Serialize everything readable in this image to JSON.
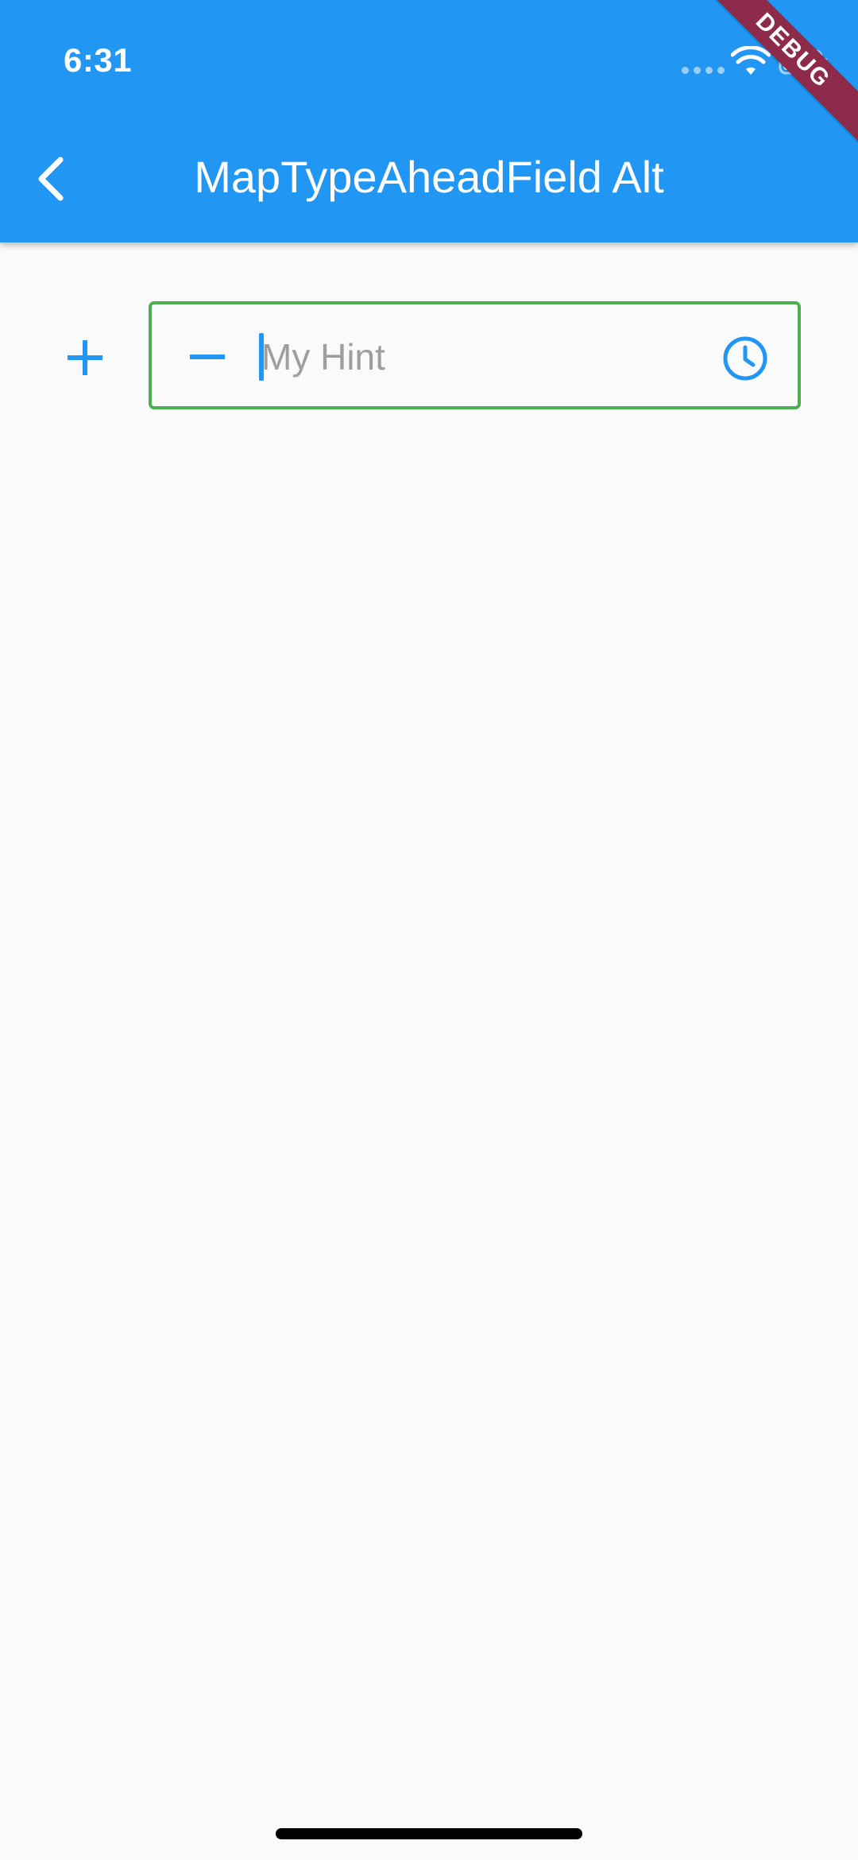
{
  "status_bar": {
    "time": "6:31"
  },
  "app_bar": {
    "title": "MapTypeAheadField Alt",
    "back_icon": "chevron-left-icon",
    "color": "#2196F3"
  },
  "debug_banner": {
    "label": "DEBUG",
    "color": "#8E2A4A"
  },
  "form": {
    "add_icon": "plus-icon",
    "remove_icon": "minus-icon",
    "field": {
      "value": "",
      "placeholder": "My Hint",
      "border_color": "#4CAF50",
      "trailing_icon": "clock-icon"
    },
    "accent_color": "#2196F3"
  }
}
